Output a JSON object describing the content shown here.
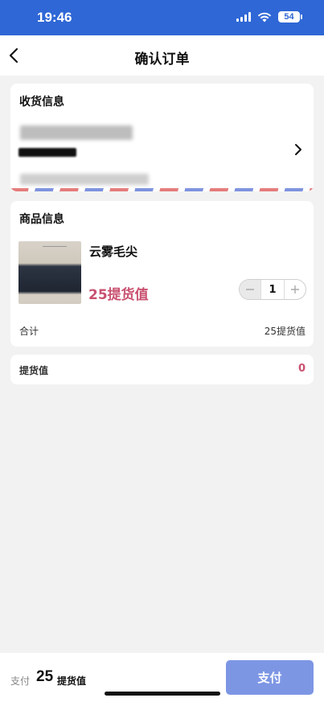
{
  "status_bar": {
    "time": "19:46",
    "battery": "54",
    "icons": [
      "signal-icon",
      "wifi-icon",
      "battery-icon"
    ]
  },
  "nav": {
    "title": "确认订单",
    "back_icon": "chevron-left-icon"
  },
  "address": {
    "title": "收货信息",
    "chevron_icon": "chevron-right-icon"
  },
  "product_section": {
    "title": "商品信息",
    "item": {
      "name": "云雾毛尖",
      "price": "25提货值",
      "quantity": "1"
    },
    "total_label": "合计",
    "total_value": "25提货值"
  },
  "delivery": {
    "label": "提货值",
    "value": "0"
  },
  "footer": {
    "pay_label": "支付",
    "pay_amount": "25",
    "pay_unit": "提货值",
    "pay_button": "支付"
  },
  "colors": {
    "brand_blue": "#2f67d6",
    "pay_button": "#7d96e4",
    "price_accent": "#c9506f"
  }
}
